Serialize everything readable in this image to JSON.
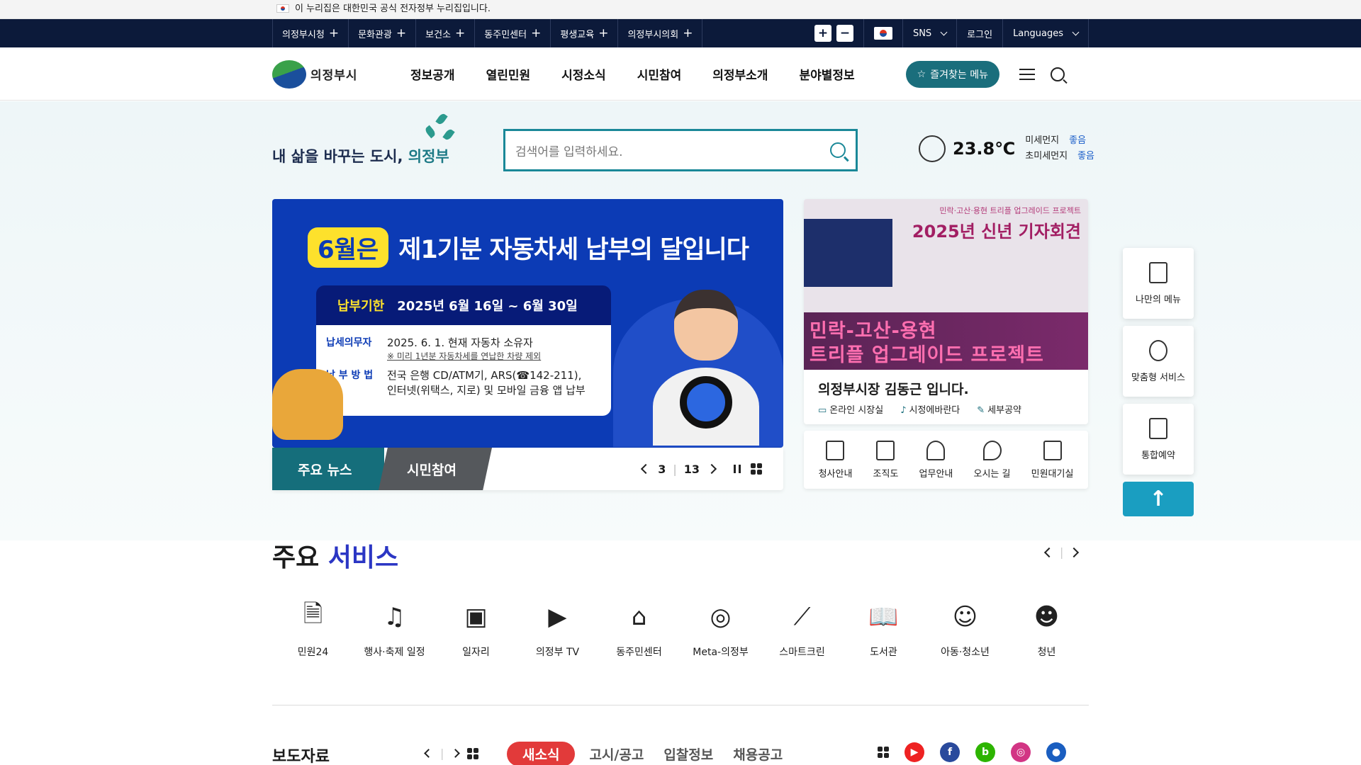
{
  "gov_notice": "이 누리집은 대한민국 공식 전자정부 누리집입니다.",
  "topbar": {
    "items": [
      "의정부시청",
      "문화관광",
      "보건소",
      "동주민센터",
      "평생교육",
      "의정부시의회"
    ],
    "sns": "SNS",
    "login": "로그인",
    "languages": "Languages"
  },
  "header": {
    "logo_text": "의정부시",
    "nav": [
      "정보공개",
      "열린민원",
      "시정소식",
      "시민참여",
      "의정부소개",
      "분야별정보"
    ],
    "favorite_menu": "즐겨찾는 메뉴"
  },
  "search": {
    "placeholder": "검색어를 입력하세요."
  },
  "slogan": {
    "prefix": "내 삶을 바꾸는 도시,",
    "city": "의정부"
  },
  "weather": {
    "temp": "23.8℃",
    "fine_dust_label": "미세먼지",
    "fine_dust": "좋음",
    "ultra_dust_label": "초미세먼지",
    "ultra_dust": "좋음"
  },
  "banner": {
    "month": "6월은",
    "title": "제1기분 자동차세 납부의 달입니다",
    "deadline_label": "납부기한",
    "deadline": "2025년 6월 16일 ~ 6월 30일",
    "taxpayer_label": "납세의무자",
    "taxpayer": "2025. 6. 1. 현재 자동차 소유자",
    "taxpayer_note": "※ 미리 1년분 자동차세를 연납한 차량 제외",
    "method_label": "납 부 방 법",
    "method_1": "전국 은행 CD/ATM기, ARS(☎142-211),",
    "method_2": "인터넷(위택스, 지로) 및 모바일 금융 앱 납부"
  },
  "slider": {
    "tab_news": "주요 뉴스",
    "tab_participation": "시민참여",
    "current": "3",
    "total": "13"
  },
  "mayor": {
    "img_sub": "민락·고산·용현 트리플 업그레이드 프로젝트",
    "img_title": "2025년 신년 기자회견",
    "img_band_1": "민락-고산-용현",
    "img_band_2": "트리플 업그레이드 프로젝트",
    "name_line": "의정부시장 김동근 입니다.",
    "links": [
      "온라인 시장실",
      "시정에바란다",
      "세부공약"
    ]
  },
  "quick_links": [
    "청사안내",
    "조직도",
    "업무안내",
    "오시는 길",
    "민원대기실"
  ],
  "side_menu": [
    "나만의 메뉴",
    "맞춤형 서비스",
    "통합예약"
  ],
  "services": {
    "title_1": "주요",
    "title_2": "서비스",
    "items": [
      {
        "label": "민원24",
        "icon": "document-24-icon"
      },
      {
        "label": "행사·축제 일정",
        "icon": "music-notes-icon"
      },
      {
        "label": "일자리",
        "icon": "briefcase-icon"
      },
      {
        "label": "의정부 TV",
        "icon": "tv-play-icon"
      },
      {
        "label": "동주민센터",
        "icon": "house-person-icon"
      },
      {
        "label": "Meta-의정부",
        "icon": "planet-icon"
      },
      {
        "label": "스마트크린",
        "icon": "broom-icon"
      },
      {
        "label": "도서관",
        "icon": "book-icon"
      },
      {
        "label": "아동·청소년",
        "icon": "child-icon"
      },
      {
        "label": "청년",
        "icon": "youth-icon"
      }
    ]
  },
  "press": {
    "title": "보도자료"
  },
  "news_tabs": [
    "새소식",
    "고시/공고",
    "입찰정보",
    "채용공고"
  ],
  "colors": {
    "navy": "#0c1a3a",
    "teal": "#1a6e7c",
    "banner_blue": "#0c3bb5",
    "accent_red": "#e23a3a",
    "service_blue": "#2b36c4"
  }
}
